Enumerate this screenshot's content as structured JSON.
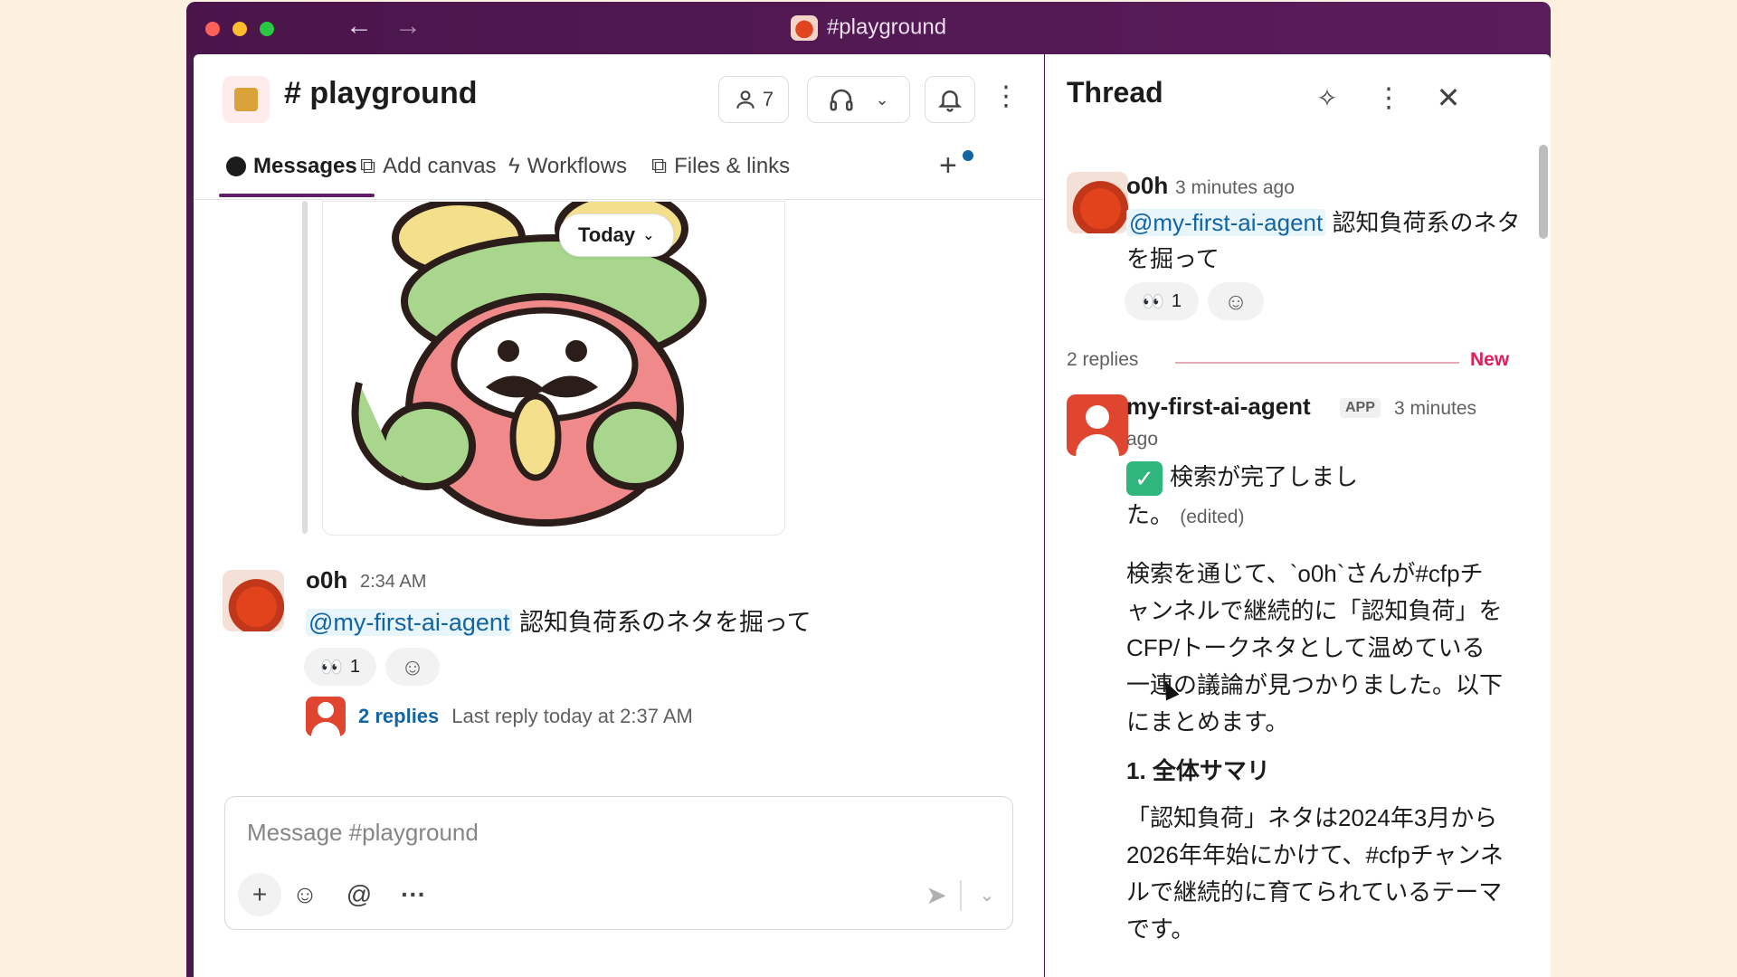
{
  "window": {
    "title": "#playground"
  },
  "channel": {
    "name": "playground",
    "hash": "#",
    "member_count": "7",
    "tabs": [
      {
        "label": "Messages",
        "active": true
      },
      {
        "label": "Add canvas"
      },
      {
        "label": "Workflows"
      },
      {
        "label": "Files & links"
      }
    ],
    "today_label": "Today"
  },
  "message": {
    "author": "o0h",
    "time": "2:34 AM",
    "mention": "@my-first-ai-agent",
    "text": "認知負荷系のネタを掘って",
    "reaction_emoji": "👀",
    "reaction_count": "1",
    "replies_label": "2 replies",
    "last_reply": "Last reply today at 2:37 AM"
  },
  "composer": {
    "placeholder": "Message #playground"
  },
  "thread": {
    "title": "Thread",
    "parent": {
      "author": "o0h",
      "time": "3 minutes ago",
      "mention": "@my-first-ai-agent",
      "text": "認知負荷系のネタを掘って",
      "reaction_emoji": "👀",
      "reaction_count": "1"
    },
    "reply_count": "2 replies",
    "new_label": "New",
    "bot": {
      "name": "my-first-ai-agent",
      "badge": "APP",
      "time_part1": "3 minutes",
      "time_part2": "ago",
      "status": "検索が完了しました。",
      "edited": "(edited)",
      "para1": "検索を通じて、`o0h`さんが#cfpチャンネルで継続的に「認知負荷」をCFP/トークネタとして温めている一連の議論が見つかりました。以下にまとめます。",
      "heading": "1. 全体サマリ",
      "para2": "「認知負荷」ネタは2024年3月から2026年年始にかけて、#cfpチャンネルで継続的に育てられているテーマです。"
    }
  }
}
